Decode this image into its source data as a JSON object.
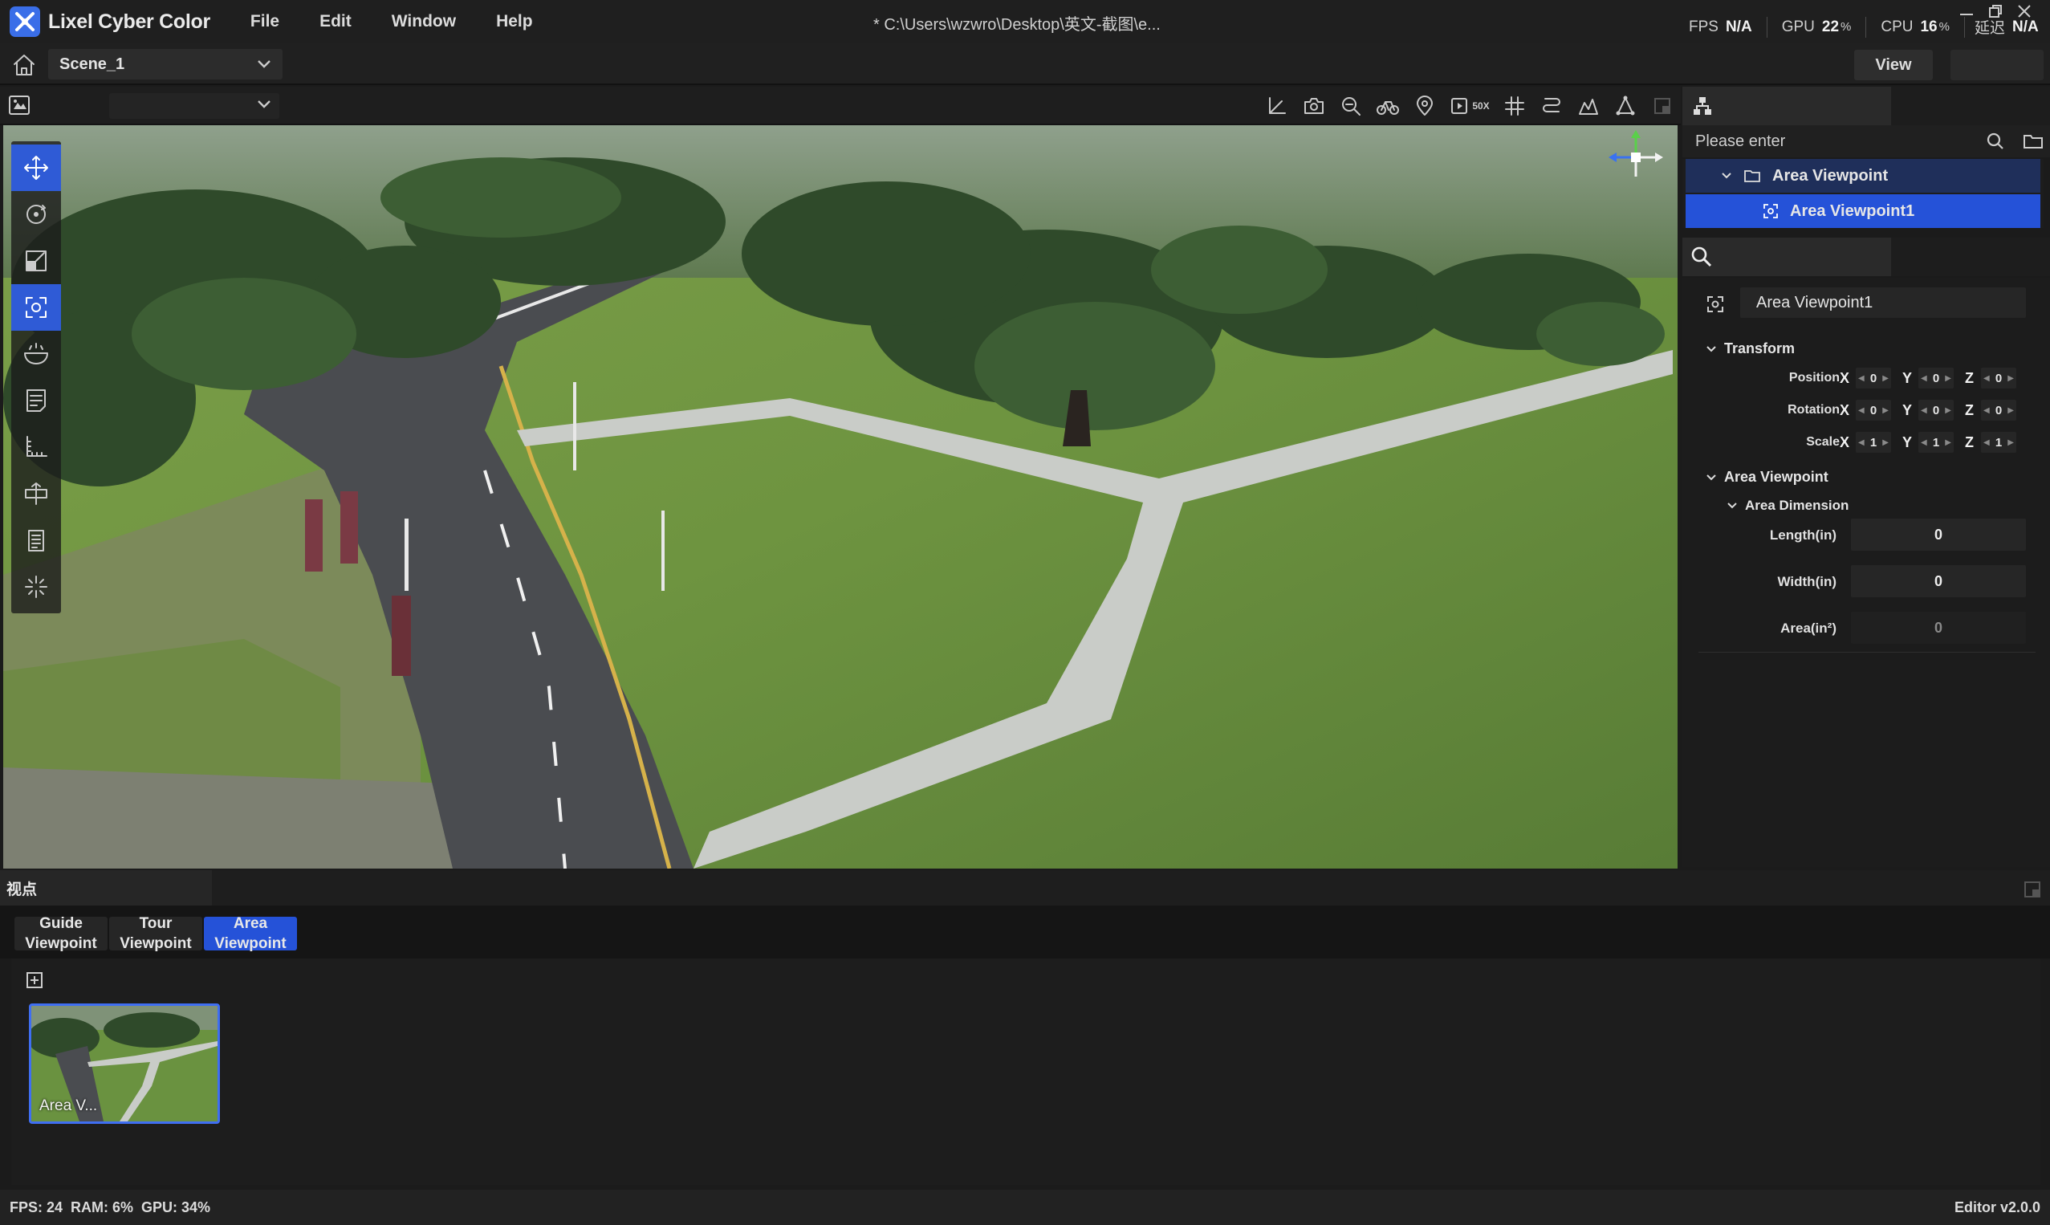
{
  "app": {
    "name": "Lixel Cyber Color",
    "file_path": "* C:\\Users\\wzwro\\Desktop\\英文-截图\\e..."
  },
  "menus": [
    "File",
    "Edit",
    "Window",
    "Help"
  ],
  "stats": {
    "fps_label": "FPS",
    "fps_value": "N/A",
    "gpu_label": "GPU",
    "gpu_value": "22",
    "cpu_label": "CPU",
    "cpu_value": "16",
    "percent": "%",
    "latency_label": "延迟",
    "latency_value": "N/A"
  },
  "scene": {
    "selected": "Scene_1",
    "view_button": "View"
  },
  "viewport_toolbar": {
    "speed_label": "50X"
  },
  "right_panel": {
    "search_placeholder": "Please enter",
    "tree": [
      {
        "label": "Area Viewpoint"
      },
      {
        "label": "Area Viewpoint1"
      }
    ],
    "object_name": "Area Viewpoint1",
    "transform": {
      "title": "Transform",
      "position": {
        "label": "Position",
        "x": "0",
        "y": "0",
        "z": "0"
      },
      "rotation": {
        "label": "Rotation",
        "x": "0",
        "y": "0",
        "z": "0"
      },
      "scale": {
        "label": "Scale",
        "x": "1",
        "y": "1",
        "z": "1"
      },
      "axis_x": "X",
      "axis_y": "Y",
      "axis_z": "Z"
    },
    "area_viewpoint": {
      "title": "Area Viewpoint",
      "dimension_title": "Area Dimension",
      "length": {
        "label": "Length(in)",
        "value": "0"
      },
      "width": {
        "label": "Width(in)",
        "value": "0"
      },
      "area": {
        "label": "Area(in²)",
        "value": "0"
      }
    }
  },
  "bottom_panel": {
    "title": "视点",
    "tabs": [
      {
        "line1": "Guide",
        "line2": "Viewpoint"
      },
      {
        "line1": "Tour",
        "line2": "Viewpoint"
      },
      {
        "line1": "Area",
        "line2": "Viewpoint"
      }
    ],
    "active_tab": 2,
    "thumbnail_label": "Area V..."
  },
  "status_bar": {
    "left": "FPS: 24  RAM: 6%  GPU: 34%",
    "right": "Editor v2.0.0"
  },
  "colors": {
    "accent": "#2552d8",
    "tree_parent_bg": "#1f2f5a",
    "panel_bg": "#1c1c1c"
  }
}
